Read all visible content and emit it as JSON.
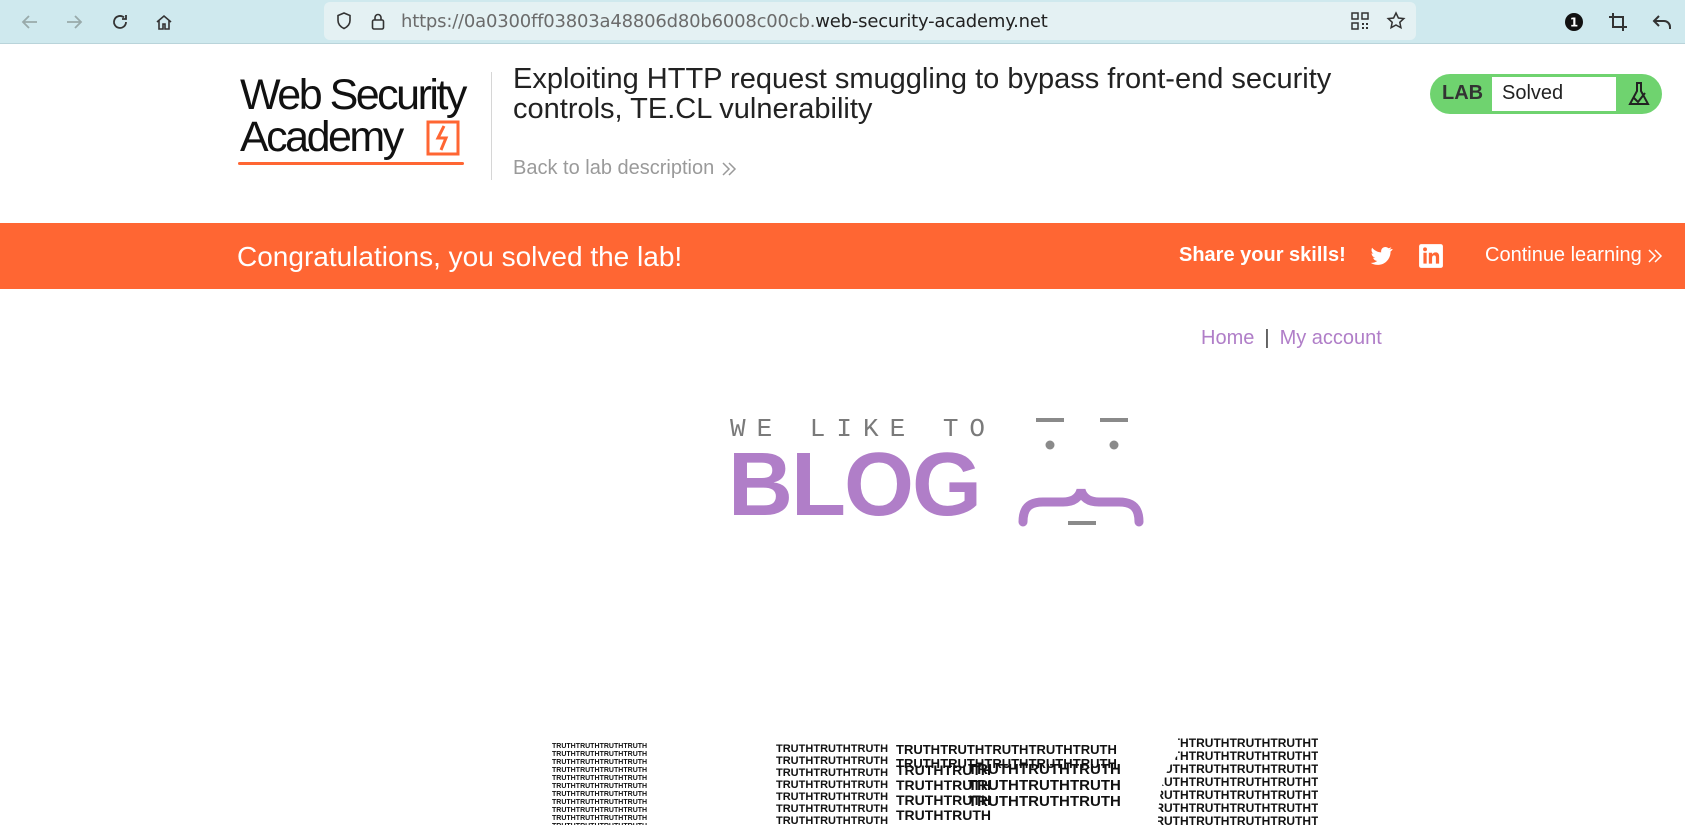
{
  "browser": {
    "url_dim": "https://0a0300ff03803a48806d80b6008c00cb.",
    "url_domain": "web-security-academy.net",
    "notification_count": "1"
  },
  "academy_logo": {
    "line1": "Web Security",
    "line2": "Academy"
  },
  "lab": {
    "title": "Exploiting HTTP request smuggling to bypass front-end security controls, TE.CL vulnerability",
    "back_label": "Back to lab description",
    "status_tag": "LAB",
    "status_value": "Solved"
  },
  "banner": {
    "message": "Congratulations, you solved the lab!",
    "share_label": "Share your skills!",
    "continue_label": "Continue learning"
  },
  "blog_nav": {
    "home": "Home",
    "separator": "|",
    "account": "My account"
  },
  "blog_logo": {
    "tagline": "WE LIKE TO",
    "word": "BLOG"
  },
  "truth_image": {
    "word": "TRUTH"
  },
  "colors": {
    "accent": "#ff6633",
    "blog_purple": "#b07ec8",
    "lab_green": "#6fd36f"
  }
}
